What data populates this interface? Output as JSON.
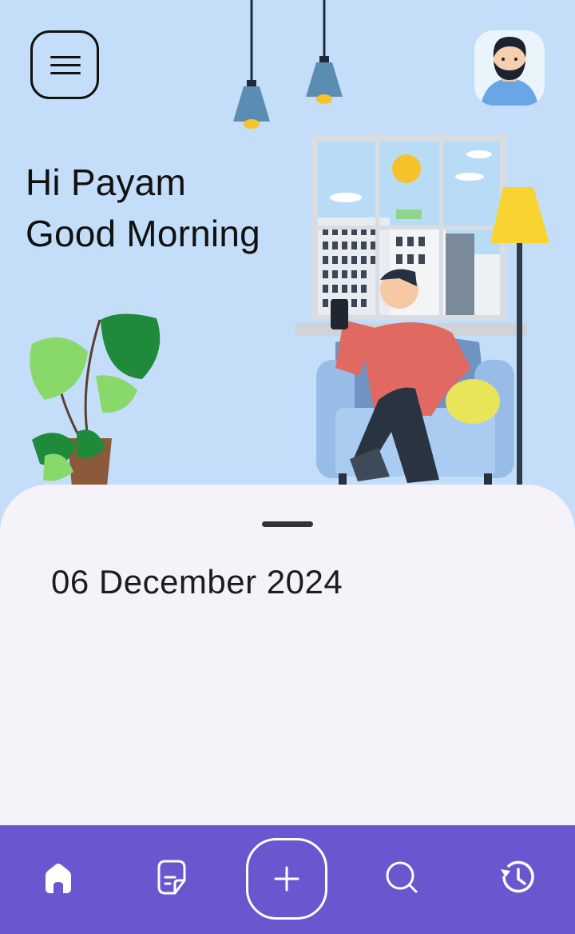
{
  "header": {
    "menu_icon": "hamburger-menu-icon",
    "avatar_icon": "user-avatar"
  },
  "greeting": {
    "line1": "Hi Payam",
    "line2": "Good Morning"
  },
  "sheet": {
    "date": "06 December 2024"
  },
  "nav": {
    "items": [
      {
        "icon": "home-icon"
      },
      {
        "icon": "notes-icon"
      },
      {
        "icon": "plus-icon"
      },
      {
        "icon": "search-icon"
      },
      {
        "icon": "history-icon"
      }
    ]
  },
  "colors": {
    "background": "#c4def9",
    "sheet": "#f6f2fa",
    "nav": "#6a57cf"
  }
}
